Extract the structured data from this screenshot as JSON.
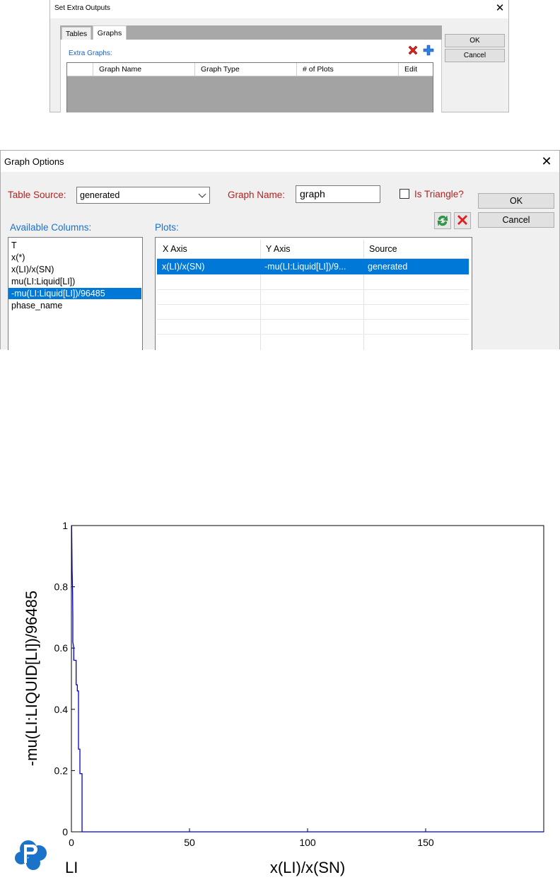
{
  "extra_outputs": {
    "title": "Set Extra Outputs",
    "close_glyph": "✕",
    "tabs": [
      "Tables",
      "Graphs"
    ],
    "active_tab": "Graphs",
    "section_label": "Extra Graphs:",
    "columns": [
      "Graph Name",
      "Graph Type",
      "# of Plots",
      "Edit"
    ],
    "rows": [],
    "ok_label": "OK",
    "cancel_label": "Cancel",
    "icons": [
      "delete-icon",
      "add-icon"
    ]
  },
  "graph_options": {
    "title": "Graph Options",
    "close_glyph": "✕",
    "table_source_label": "Table Source:",
    "table_source_value": "generated",
    "graph_name_label": "Graph Name:",
    "graph_name_value": "graph",
    "is_triangle_label": "Is Triangle?",
    "is_triangle_checked": false,
    "ok_label": "OK",
    "cancel_label": "Cancel",
    "available_columns_label": "Available Columns:",
    "available_columns": [
      "T",
      "x(*)",
      "x(LI)/x(SN)",
      "mu(LI:Liquid[LI])",
      "-mu(LI:Liquid[LI])/96485",
      "phase_name"
    ],
    "selected_column": "-mu(LI:Liquid[LI])/96485",
    "plots_label": "Plots:",
    "plot_columns": [
      "X Axis",
      "Y Axis",
      "Source"
    ],
    "plots": [
      {
        "x": "x(LI)/x(SN)",
        "y": "-mu(LI:Liquid[LI])/9...",
        "source": "generated"
      }
    ],
    "colors": {
      "label_red": "#b22222",
      "label_blue": "#1a6fd1",
      "selection": "#0078d7"
    }
  },
  "chart_data": {
    "type": "line",
    "title": "",
    "xlabel": "x(LI)/x(SN)",
    "ylabel": "-mu(LI:LIQUID[LI])/96485",
    "corner_label": "LI",
    "xlim": [
      0,
      200
    ],
    "ylim": [
      0,
      1
    ],
    "xticks": [
      0,
      50,
      100,
      150
    ],
    "yticks": [
      0,
      0.2,
      0.4,
      0.6,
      0.8,
      1
    ],
    "xtick_labels": [
      "0",
      "50",
      "100",
      "150"
    ],
    "ytick_labels": [
      "0",
      "0.2",
      "0.4",
      "0.6",
      "0.8",
      "1"
    ],
    "grid": false,
    "line_color": "#0000cc",
    "series": [
      {
        "x": [
          0.1,
          0.3,
          0.5,
          0.6,
          0.6,
          1.0,
          1.0,
          2.0,
          2.0,
          2.5,
          2.5,
          3.0,
          3.0,
          3.6,
          3.6,
          4.5,
          4.5,
          200
        ],
        "y": [
          1.0,
          0.85,
          0.78,
          0.7,
          0.62,
          0.6,
          0.56,
          0.56,
          0.48,
          0.48,
          0.46,
          0.46,
          0.27,
          0.27,
          0.19,
          0.19,
          0.0,
          0.0
        ]
      }
    ]
  }
}
